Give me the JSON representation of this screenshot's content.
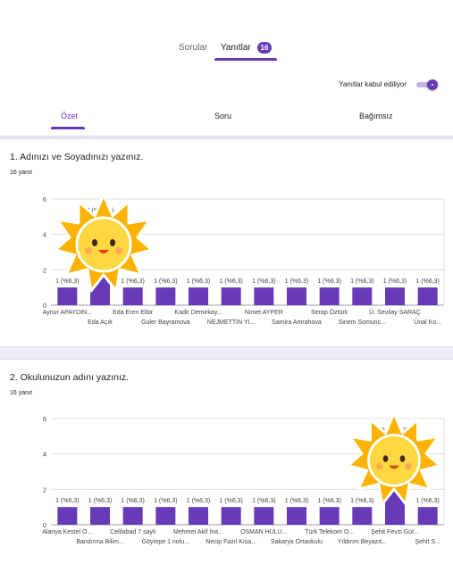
{
  "tabs": [
    {
      "label": "Sorular",
      "active": false
    },
    {
      "label": "Yanıtlar",
      "active": true,
      "badge": "16"
    }
  ],
  "settings": {
    "accepting_label": "Yanıtlar kabul ediliyor",
    "accepting": true
  },
  "subtabs": [
    {
      "label": "Özet",
      "active": true
    },
    {
      "label": "Soru",
      "active": false
    },
    {
      "label": "Bağımsız",
      "active": false
    }
  ],
  "questions": [
    {
      "title": "1. Adınızı ve Soyadınızı yazınız.",
      "count": "16 yanıt"
    },
    {
      "title": "2. Okulunuzun adını yazınız.",
      "count": "16 yanıt"
    }
  ],
  "colors": {
    "accent": "#673ab7",
    "bar": "#673ab7"
  },
  "chart_data": [
    {
      "type": "bar",
      "ylim": [
        0,
        6
      ],
      "yticks": [
        0,
        2,
        4,
        6
      ],
      "grid": true,
      "categories": [
        "Aynur APAYDIN...",
        "Eda Açık",
        "Eda Eren Elbir",
        "Guler Bayramova",
        "Kadir Demirkay...",
        "NEJMETTİN YI...",
        "Nimet AYPER",
        "Samira Amrahova",
        "Serap Öztürk",
        "Sinem Somunc...",
        "Ü. Sevilay SARAÇ",
        "Ünal Ko..."
      ],
      "values": [
        1,
        5,
        1,
        1,
        1,
        1,
        1,
        1,
        1,
        1,
        1,
        1
      ],
      "labels": [
        "1 (%6,3)",
        "5 (%31,3)",
        "1 (%6,3)",
        "1 (%6,3)",
        "1 (%6,3)",
        "1 (%6,3)",
        "1 (%6,3)",
        "1 (%6,3)",
        "1 (%6,3)",
        "1 (%6,3)",
        "1 (%6,3)",
        "1 (%6,3)"
      ]
    },
    {
      "type": "bar",
      "ylim": [
        0,
        6
      ],
      "yticks": [
        0,
        2,
        4,
        6
      ],
      "grid": true,
      "categories": [
        "Alanya Kestel O...",
        "Bandırma Bilim...",
        "Celilabad 7 sayli",
        "Göytepe 1 nolu...",
        "Mehmet Akif İna...",
        "Necip Fazıl Kısa...",
        "OSMAN HULU...",
        "Sakarya Ortaokulu",
        "Türk Telekom O...",
        "Yıldırım Beyazıt...",
        "Şehit Fevzi Gür...",
        "Şehit S..."
      ],
      "values": [
        1,
        1,
        1,
        1,
        1,
        1,
        1,
        1,
        1,
        1,
        5,
        1
      ],
      "labels": [
        "1 (%6,3)",
        "1 (%6,3)",
        "1 (%6,3)",
        "1 (%6,3)",
        "1 (%6,3)",
        "1 (%6,3)",
        "1 (%6,3)",
        "1 (%6,3)",
        "1 (%6,3)",
        "1 (%6,3)",
        "5 (%31,3)",
        "1 (%6,3)"
      ]
    }
  ]
}
